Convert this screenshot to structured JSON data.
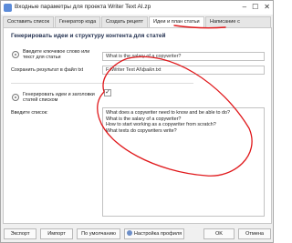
{
  "window": {
    "title": "Входные параметры для проекта Writer Text AI.zp",
    "minimize_label": "–",
    "maximize_label": "☐",
    "close_label": "✕"
  },
  "tabs": [
    {
      "label": "Составить список"
    },
    {
      "label": "Генератор кода"
    },
    {
      "label": "Создать рецепт"
    },
    {
      "label": "Идеи и план статьи"
    },
    {
      "label": "Написание с"
    }
  ],
  "panel": {
    "heading": "Генерировать идеи и структуру контента для статей",
    "keyword": {
      "label": "Введите ключевое слово или текст для статьи",
      "value": "What is the salary of a copywriter?"
    },
    "save_to": {
      "label": "Сохранить результат в файл txt",
      "value": "F:\\Writer Text AI\\файл.txt"
    },
    "generate_list": {
      "label": "Генерировать идеи и заголовки статей списком",
      "checked_glyph": "✓"
    },
    "list": {
      "label": "Введите список:",
      "lines": [
        "What does a copywriter need to know and be able to do?",
        "What is the salary of a copywriter?",
        "How to start working as a copywriter from scratch?",
        "What texts do copywriters write?"
      ]
    }
  },
  "footer": {
    "export": "Экспорт",
    "import": "Импорт",
    "default": "По умолчанию",
    "profile": "Настройка профиля",
    "ok": "OK",
    "cancel": "Отмена"
  },
  "colors": {
    "annotation": "#e0181b",
    "heading": "#1f2d4d"
  },
  "icons": [
    "app-icon",
    "info-icon",
    "checkbox-icon",
    "settings-gear-icon"
  ]
}
